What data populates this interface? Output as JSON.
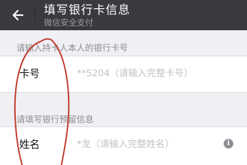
{
  "header": {
    "title": "填写银行卡信息",
    "subtitle": "微信安全支付",
    "back_icon": "back-arrow-icon"
  },
  "card_section": {
    "label": "请输入持卡人本人的银行卡号",
    "field_label": "卡号",
    "placeholder": "**5204（请输入完整卡号）"
  },
  "info_section": {
    "label": "请填写银行预留信息",
    "field_label": "姓名",
    "placeholder": "*龙（请输入完整姓名）",
    "info_icon": "info-icon"
  },
  "colors": {
    "header_bg": "#393a3f",
    "page_bg": "#efeff4",
    "annotation_red": "#c0392b"
  }
}
